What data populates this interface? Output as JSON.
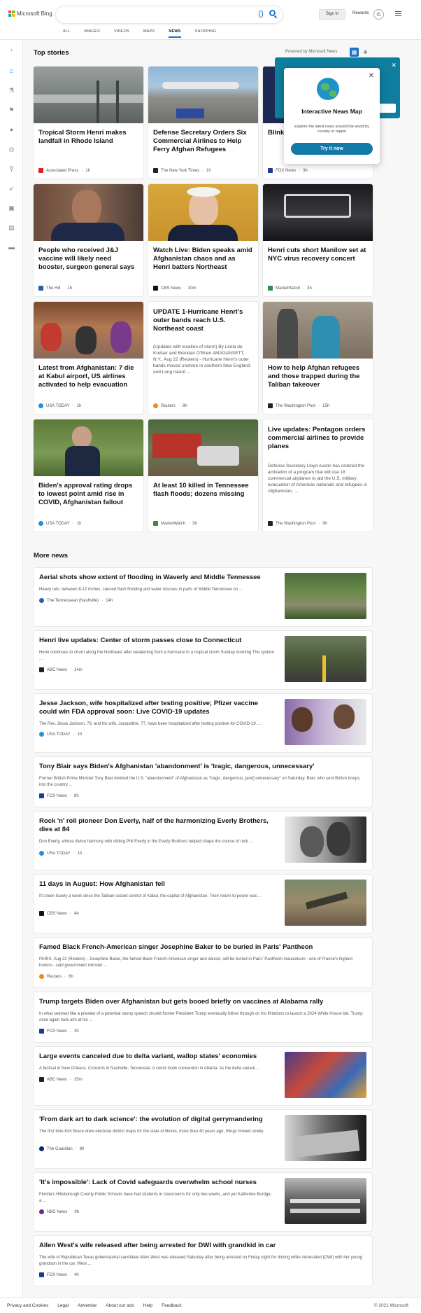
{
  "header": {
    "brand": "Microsoft Bing",
    "signin": "Sign in",
    "rewards": "Rewards",
    "tabs": [
      "ALL",
      "IMAGES",
      "VIDEOS",
      "MAPS",
      "NEWS",
      "SHOPPING"
    ],
    "active_tab": "NEWS",
    "accent_color": "#1a73c8"
  },
  "sidebar": {
    "icons": [
      "expand-icon",
      "home-icon",
      "science-icon",
      "flag-icon",
      "map-pin-icon",
      "globe-icon",
      "microscope-icon",
      "rocket-icon",
      "film-icon",
      "building-icon",
      "card-icon"
    ]
  },
  "top_stories": {
    "heading": "Top stories",
    "powered": "Powered by Microsoft News",
    "cards": [
      {
        "title": "Tropical Storm Henri makes landfall in Rhode Island",
        "source": "Associated Press",
        "age": "1h",
        "has_image": true
      },
      {
        "title": "Defense Secretary Orders Six Commercial Airlines to Help Ferry Afghan Refugees",
        "source": "The New York Times",
        "age": "1h",
        "has_image": true
      },
      {
        "title": "Blink... 'gone... Biden...",
        "source": "FOX News",
        "age": "3h",
        "has_image": true
      },
      {
        "title": "People who received J&J vaccine will likely need booster, surgeon general says",
        "source": "The Hill",
        "age": "1h",
        "has_image": true
      },
      {
        "title": "Watch Live: Biden speaks amid Afghanistan chaos and as Henri batters Northeast",
        "source": "CBS News",
        "age": "30m",
        "has_image": true
      },
      {
        "title": "Henri cuts short Manilow set at NYC virus recovery concert",
        "source": "MarketWatch",
        "age": "3h",
        "has_image": true
      },
      {
        "title": "Latest from Afghanistan: 7 die at Kabul airport, US airlines activated to help evacuation",
        "source": "USA TODAY",
        "age": "1h",
        "has_image": true
      },
      {
        "title": "UPDATE 1-Hurricane Henri's outer bands reach U.S. Northeast coast",
        "snippet": "(Updates with location of storm) By Leela de Kretser and Brendan O'Brien AMAGANSETT, N.Y., Aug 22 (Reuters) - Hurricane Henri's outer bands moved onshore in southern New England and Long Island ...",
        "source": "Reuters",
        "age": "8h",
        "has_image": false
      },
      {
        "title": "How to help Afghan refugees and those trapped during the Taliban takeover",
        "source": "The Washington Post",
        "age": "15h",
        "has_image": true
      },
      {
        "title": "Biden's approval rating drops to lowest point amid rise in COVID, Afghanistan fallout",
        "source": "USA TODAY",
        "age": "1h",
        "has_image": true
      },
      {
        "title": "At least 10 killed in Tennessee flash floods; dozens missing",
        "source": "MarketWatch",
        "age": "3h",
        "has_image": true
      },
      {
        "title": "Live updates: Pentagon orders commercial airlines to provide planes",
        "snippet": "Defense Secretary Lloyd Austin has ordered the activation of a program that will use 18 commercial airplanes to aid the U.S. military evacuation of American nationals and refugees in Afghanistan. ...",
        "source": "The Washington Post",
        "age": "9h",
        "has_image": false
      }
    ]
  },
  "popup": {
    "title": "Interactive News Map",
    "description": "Explore the latest news around the world by country or region",
    "button": "Try it now"
  },
  "more_news": {
    "heading": "More news",
    "items": [
      {
        "title": "Aerial shots show extent of flooding in Waverly and Middle Tennessee",
        "snippet": "Heavy rain, between 8-12 inches, caused flash flooding and water rescues in parts of Middle Tennessee on ...",
        "source": "The Tennessean (Nashville)",
        "age": "14h"
      },
      {
        "title": "Henri live updates: Center of storm passes close to Connecticut",
        "snippet": "Henri continues to churn along the Northeast after weakening from a hurricane to a tropical storm Sunday morning.The system ...",
        "source": "ABC News",
        "age": "14m"
      },
      {
        "title": "Jesse Jackson, wife hospitalized after testing positive; Pfizer vaccine could win FDA approval soon: Live COVID-19 updates",
        "snippet": "The Rev. Jesse Jackson, 79, and his wife, Jacqueline, 77, have been hospitalized after testing positive for COVID-19. ...",
        "source": "USA TODAY",
        "age": "1h"
      },
      {
        "title": "Tony Blair says Biden's Afghanistan 'abandonment' is 'tragic, dangerous, unnecessary'",
        "snippet": "Former British Prime Minister Tony Blair derided the U.S. \"abandonment\" of Afghanistan as \"tragic, dangerous, [and] unnecessary\" on Saturday. Blair, who sent British troops into the country ...",
        "source": "FOX News",
        "age": "8h"
      },
      {
        "title": "Rock 'n' roll pioneer Don Everly, half of the harmonizing Everly Brothers, dies at 84",
        "snippet": "Don Everly, whose divine harmony with sibling Phil Everly in the Everly Brothers helped shape the course of rock ...",
        "source": "USA TODAY",
        "age": "1h"
      },
      {
        "title": "11 days in August: How Afghanistan fell",
        "snippet": "It's been barely a week since the Taliban seized control of Kabul, the capital of Afghanistan. Their return to power was ...",
        "source": "CBS News",
        "age": "4h"
      },
      {
        "title": "Famed Black French-American singer Josephine Baker to be buried in Paris' Pantheon",
        "snippet": "PARIS, Aug 22 (Reuters) - Josephine Baker, the famed Black French-American singer and dancer, will be buried in Paris' Pantheon mausoleum - one of France's highest honors - said government minister ...",
        "source": "Reuters",
        "age": "6h"
      },
      {
        "title": "Trump targets Biden over Afghanistan but gets booed briefly on vaccines at Alabama rally",
        "snippet": "In what seemed like a preview of a potential stump speech should former President Trump eventually follow through on his flirtations to launch a 2024 White House bid, Trump once again took aim at his ...",
        "source": "FOX News",
        "age": "3h"
      },
      {
        "title": "Large events canceled due to delta variant, wallop states' economies",
        "snippet": "A festival in New Orleans. Concerts in Nashville, Tennessee. A comic book convention in Atlanta. As the delta variant ...",
        "source": "ABC News",
        "age": "35m"
      },
      {
        "title": "'From dark art to dark science': the evolution of digital gerrymandering",
        "snippet": "The first time Kim Brace drew electoral district maps for the state of Illinois, more than 40 years ago, things moved slowly.",
        "source": "The Guardian",
        "age": "8h"
      },
      {
        "title": "'It's impossible': Lack of Covid safeguards overwhelm school nurses",
        "snippet": "Florida's Hillsborough County Public Schools have had students in classrooms for only two weeks, and yet Katherine Burdge, a ...",
        "source": "NBC News",
        "age": "9h"
      },
      {
        "title": "Allen West's wife released after being arrested for DWI with grandkid in car",
        "snippet": "The wife of Republican Texas gubernatorial candidate Allen West was released Saturday after being arrested on Friday night for driving while intoxicated (DWI) with her young grandson in the car. West ...",
        "source": "FOX News",
        "age": "4h"
      }
    ]
  },
  "footer": {
    "links": [
      "Privacy and Cookies",
      "Legal",
      "Advertise",
      "About our ads",
      "Help",
      "Feedback"
    ],
    "copyright": "© 2021 Microsoft"
  }
}
